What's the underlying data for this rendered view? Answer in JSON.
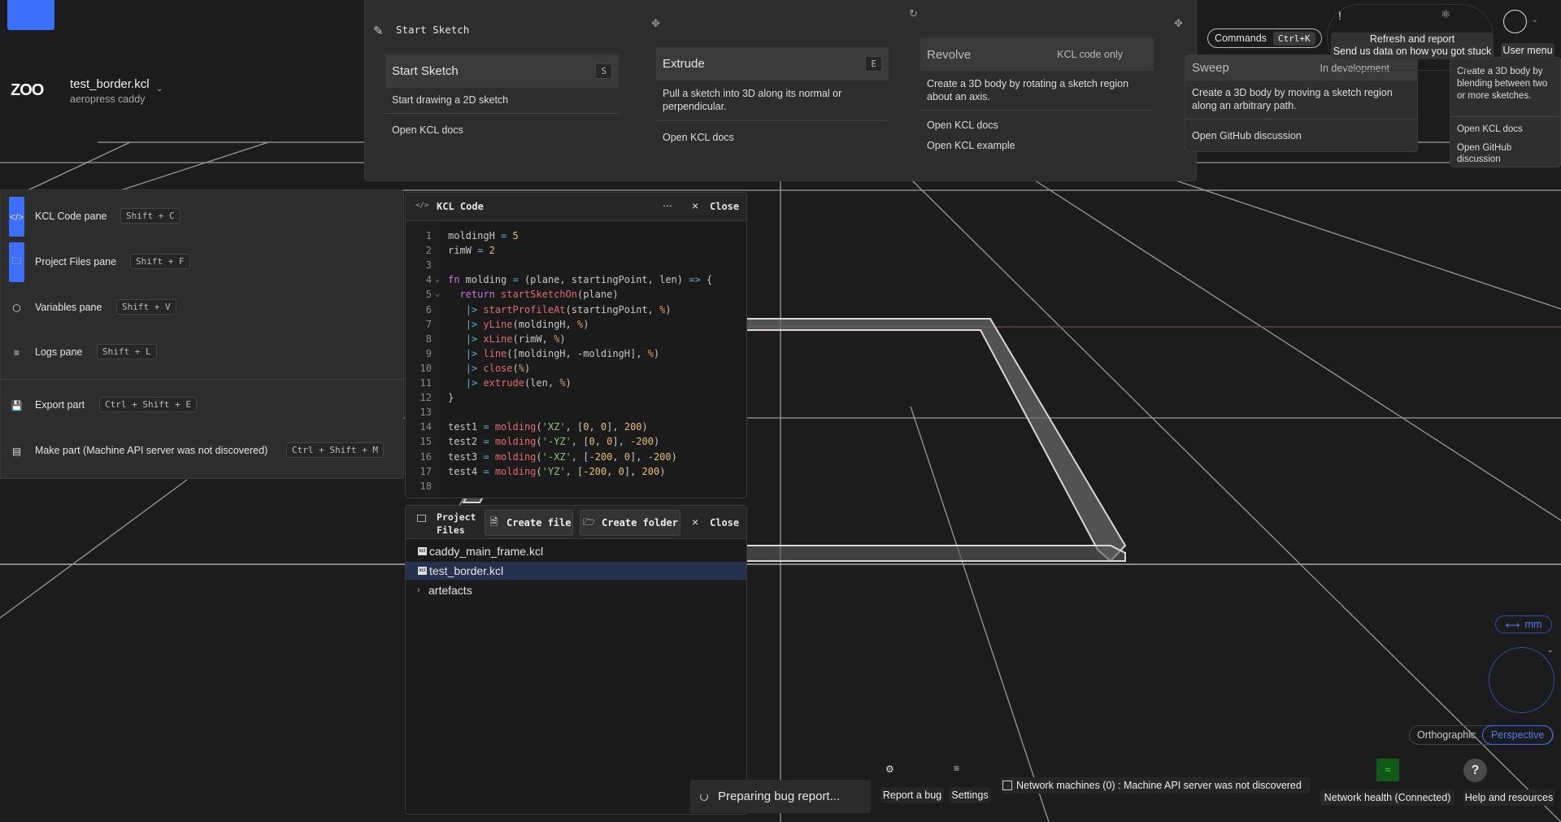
{
  "colors": {
    "accent": "#3d6ff8",
    "selected_row": "#24324f",
    "network_ok": "#0f5a14",
    "axis_red": "#7a4848"
  },
  "header": {
    "logo": "ZOO",
    "file_name": "test_border.kcl",
    "project_name": "aeropress caddy"
  },
  "toolbar": {
    "start_sketch_header": "Start Sketch",
    "cards": [
      {
        "title": "Start Sketch",
        "shortcut": "S",
        "description": "Start drawing a 2D sketch",
        "links": [
          "Open KCL docs"
        ]
      },
      {
        "title": "Extrude",
        "shortcut": "E",
        "description": "Pull a sketch into 3D along its normal or perpendicular.",
        "links": [
          "Open KCL docs"
        ]
      },
      {
        "title": "Revolve",
        "status": "KCL code only",
        "description": "Create a 3D body by rotating a sketch region about an axis.",
        "links": [
          "Open KCL docs",
          "Open KCL example"
        ]
      },
      {
        "title": "Sweep",
        "status": "In development",
        "description": "Create a 3D body by moving a sketch region along an arbitrary path.",
        "links": [
          "Open GitHub discussion"
        ]
      },
      {
        "title": "",
        "description": "Create a 3D body by blending between two or more sketches.",
        "links": [
          "Open KCL docs",
          "Open GitHub discussion"
        ]
      }
    ]
  },
  "topright": {
    "commands_label": "Commands",
    "commands_shortcut": "Ctrl+K",
    "refresh_bang": "!",
    "refresh_tooltip_title": "Refresh and report",
    "refresh_tooltip_sub": "Send us data on how you got stuck",
    "user_menu_tooltip": "User menu"
  },
  "left_panel": {
    "items": [
      {
        "label": "KCL Code pane",
        "shortcut": "Shift + C",
        "icon": "code-icon",
        "active": true
      },
      {
        "label": "Project Files pane",
        "shortcut": "Shift + F",
        "icon": "folder-icon",
        "active": true
      },
      {
        "label": "Variables pane",
        "shortcut": "Shift + V",
        "icon": "variable-icon",
        "active": false
      },
      {
        "label": "Logs pane",
        "shortcut": "Shift + L",
        "icon": "list-icon",
        "active": false
      },
      {
        "label": "Export part",
        "shortcut": "Ctrl + Shift + E",
        "icon": "export-icon",
        "active": false
      },
      {
        "label": "Make part (Machine API server was not discovered)",
        "shortcut": "Ctrl + Shift + M",
        "icon": "printer-icon",
        "active": false
      }
    ]
  },
  "code_pane": {
    "title": "KCL Code",
    "more": "⋯",
    "close": "Close",
    "lines": [
      [
        [
          "moldingH ",
          ""
        ],
        [
          "=",
          "op"
        ],
        [
          " ",
          ""
        ],
        [
          "5",
          "num"
        ]
      ],
      [
        [
          "rimW ",
          ""
        ],
        [
          "=",
          "op"
        ],
        [
          " ",
          ""
        ],
        [
          "2",
          "num"
        ]
      ],
      [],
      [
        [
          "fn",
          "kw"
        ],
        [
          " molding ",
          ""
        ],
        [
          "=",
          "op"
        ],
        [
          " (plane, startingPoint, len) ",
          ""
        ],
        [
          "=>",
          "op"
        ],
        [
          " {",
          ""
        ]
      ],
      [
        [
          "  ",
          ""
        ],
        [
          "return",
          "kw"
        ],
        [
          " ",
          ""
        ],
        [
          "startSketchOn",
          "fn"
        ],
        [
          "(plane)",
          ""
        ]
      ],
      [
        [
          "   ",
          ""
        ],
        [
          "|>",
          "pipe"
        ],
        [
          " ",
          ""
        ],
        [
          "startProfileAt",
          "fn"
        ],
        [
          "(startingPoint, ",
          ""
        ],
        [
          "%",
          "pct"
        ],
        [
          ")",
          ""
        ]
      ],
      [
        [
          "   ",
          ""
        ],
        [
          "|>",
          "pipe"
        ],
        [
          " ",
          ""
        ],
        [
          "yLine",
          "fn"
        ],
        [
          "(moldingH, ",
          ""
        ],
        [
          "%",
          "pct"
        ],
        [
          ")",
          ""
        ]
      ],
      [
        [
          "   ",
          ""
        ],
        [
          "|>",
          "pipe"
        ],
        [
          " ",
          ""
        ],
        [
          "xLine",
          "fn"
        ],
        [
          "(rimW, ",
          ""
        ],
        [
          "%",
          "pct"
        ],
        [
          ")",
          ""
        ]
      ],
      [
        [
          "   ",
          ""
        ],
        [
          "|>",
          "pipe"
        ],
        [
          " ",
          ""
        ],
        [
          "line",
          "fn"
        ],
        [
          "([moldingH, -moldingH], ",
          ""
        ],
        [
          "%",
          "pct"
        ],
        [
          ")",
          ""
        ]
      ],
      [
        [
          "   ",
          ""
        ],
        [
          "|>",
          "pipe"
        ],
        [
          " ",
          ""
        ],
        [
          "close",
          "fn"
        ],
        [
          "(",
          ""
        ],
        [
          "%",
          "pct"
        ],
        [
          ")",
          ""
        ]
      ],
      [
        [
          "   ",
          ""
        ],
        [
          "|>",
          "pipe"
        ],
        [
          " ",
          ""
        ],
        [
          "extrude",
          "fn"
        ],
        [
          "(len, ",
          ""
        ],
        [
          "%",
          "pct"
        ],
        [
          ")",
          ""
        ]
      ],
      [
        [
          "}",
          ""
        ]
      ],
      [],
      [
        [
          "test1 ",
          ""
        ],
        [
          "=",
          "op"
        ],
        [
          " ",
          ""
        ],
        [
          "molding",
          "fn"
        ],
        [
          "(",
          ""
        ],
        [
          "'XZ'",
          "str"
        ],
        [
          ", [",
          ""
        ],
        [
          "0",
          "num"
        ],
        [
          ", ",
          ""
        ],
        [
          "0",
          "num"
        ],
        [
          "], ",
          ""
        ],
        [
          "200",
          "num"
        ],
        [
          ")",
          ""
        ]
      ],
      [
        [
          "test2 ",
          ""
        ],
        [
          "=",
          "op"
        ],
        [
          " ",
          ""
        ],
        [
          "molding",
          "fn"
        ],
        [
          "(",
          ""
        ],
        [
          "'-YZ'",
          "str"
        ],
        [
          ", [",
          ""
        ],
        [
          "0",
          "num"
        ],
        [
          ", ",
          ""
        ],
        [
          "0",
          "num"
        ],
        [
          "], ",
          ""
        ],
        [
          "-200",
          "num"
        ],
        [
          ")",
          ""
        ]
      ],
      [
        [
          "test3 ",
          ""
        ],
        [
          "=",
          "op"
        ],
        [
          " ",
          ""
        ],
        [
          "molding",
          "fn"
        ],
        [
          "(",
          ""
        ],
        [
          "'-XZ'",
          "str"
        ],
        [
          ", [",
          ""
        ],
        [
          "-200",
          "num"
        ],
        [
          ", ",
          ""
        ],
        [
          "0",
          "num"
        ],
        [
          "], ",
          ""
        ],
        [
          "-200",
          "num"
        ],
        [
          ")",
          ""
        ]
      ],
      [
        [
          "test4 ",
          ""
        ],
        [
          "=",
          "op"
        ],
        [
          " ",
          ""
        ],
        [
          "molding",
          "fn"
        ],
        [
          "(",
          ""
        ],
        [
          "'YZ'",
          "str"
        ],
        [
          ", [",
          ""
        ],
        [
          "-200",
          "num"
        ],
        [
          ", ",
          ""
        ],
        [
          "0",
          "num"
        ],
        [
          "], ",
          ""
        ],
        [
          "200",
          "num"
        ],
        [
          ")",
          ""
        ]
      ],
      []
    ]
  },
  "files_pane": {
    "title": "Project Files",
    "create_file": "Create file",
    "create_folder": "Create folder",
    "close": "Close",
    "files": [
      {
        "name": "caddy_main_frame.kcl",
        "type": "file",
        "selected": false
      },
      {
        "name": "test_border.kcl",
        "type": "file",
        "selected": true
      },
      {
        "name": "artefacts",
        "type": "folder",
        "selected": false
      }
    ]
  },
  "bottom": {
    "toast": "Preparing bug report...",
    "report_bug": "Report a bug",
    "settings": "Settings",
    "network_machines": "Network machines (0) : Machine API server was not discovered",
    "network_health": "Network health (Connected)",
    "help": "Help and resources",
    "help_glyph": "?"
  },
  "view": {
    "units": "mm",
    "orthographic": "Orthographic",
    "perspective": "Perspective",
    "projection": "Perspective"
  }
}
